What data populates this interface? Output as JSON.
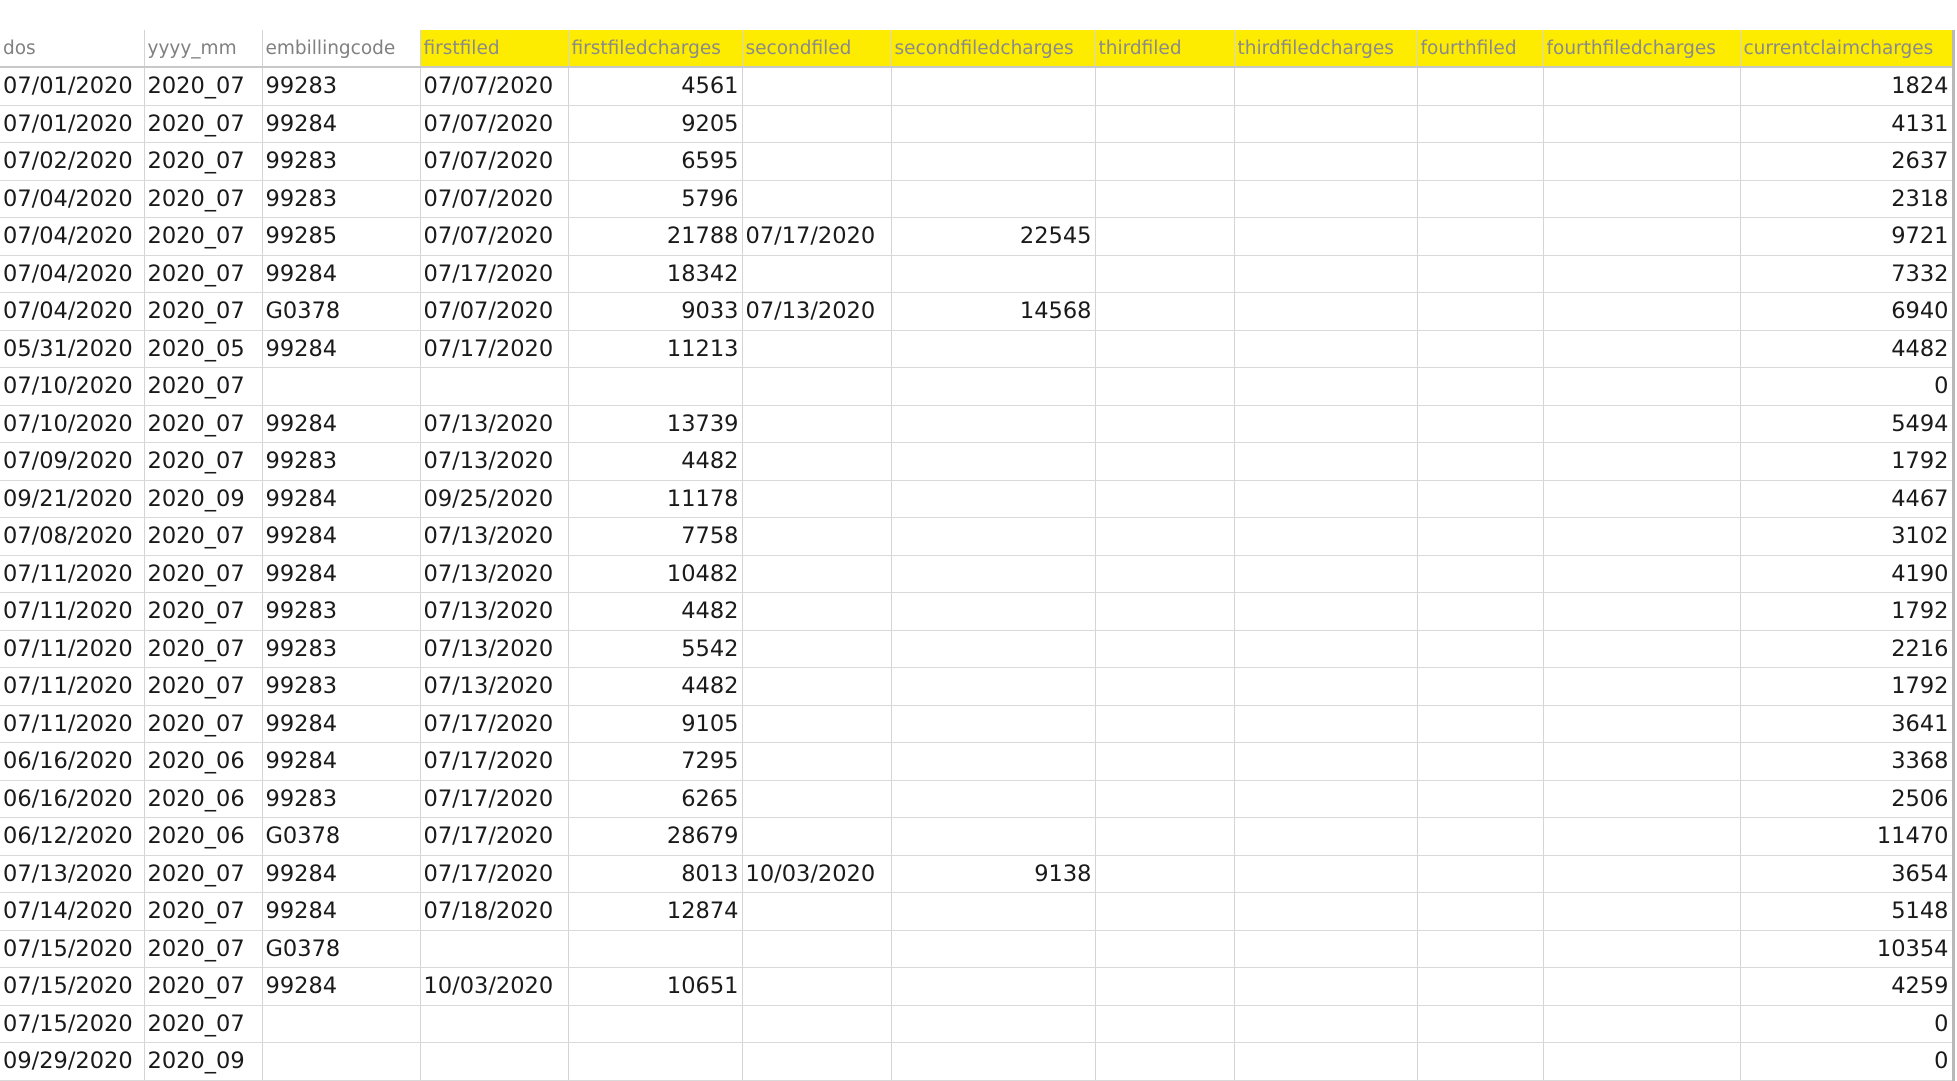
{
  "columns": [
    {
      "key": "dos",
      "label": "dos",
      "highlight": false,
      "align": "left"
    },
    {
      "key": "yyyy_mm",
      "label": "yyyy_mm",
      "highlight": false,
      "align": "left"
    },
    {
      "key": "embillingcode",
      "label": "embillingcode",
      "highlight": false,
      "align": "left"
    },
    {
      "key": "firstfiled",
      "label": "firstfiled",
      "highlight": true,
      "align": "left"
    },
    {
      "key": "firstfiledcharges",
      "label": "firstfiledcharges",
      "highlight": true,
      "align": "right"
    },
    {
      "key": "secondfiled",
      "label": "secondfiled",
      "highlight": true,
      "align": "left"
    },
    {
      "key": "secondfiledcharges",
      "label": "secondfiledcharges",
      "highlight": true,
      "align": "right"
    },
    {
      "key": "thirdfiled",
      "label": "thirdfiled",
      "highlight": true,
      "align": "left"
    },
    {
      "key": "thirdfiledcharges",
      "label": "thirdfiledcharges",
      "highlight": true,
      "align": "right"
    },
    {
      "key": "fourthfiled",
      "label": "fourthfiled",
      "highlight": true,
      "align": "left"
    },
    {
      "key": "fourthfiledcharges",
      "label": "fourthfiledcharges",
      "highlight": true,
      "align": "right"
    },
    {
      "key": "currentclaimcharges",
      "label": "currentclaimcharges",
      "highlight": true,
      "align": "right"
    }
  ],
  "highlight_color": "#fdeb00",
  "rows": [
    [
      "07/01/2020",
      "2020_07",
      "99283",
      "07/07/2020",
      "4561",
      "",
      "",
      "",
      "",
      "",
      "",
      "1824"
    ],
    [
      "07/01/2020",
      "2020_07",
      "99284",
      "07/07/2020",
      "9205",
      "",
      "",
      "",
      "",
      "",
      "",
      "4131"
    ],
    [
      "07/02/2020",
      "2020_07",
      "99283",
      "07/07/2020",
      "6595",
      "",
      "",
      "",
      "",
      "",
      "",
      "2637"
    ],
    [
      "07/04/2020",
      "2020_07",
      "99283",
      "07/07/2020",
      "5796",
      "",
      "",
      "",
      "",
      "",
      "",
      "2318"
    ],
    [
      "07/04/2020",
      "2020_07",
      "99285",
      "07/07/2020",
      "21788",
      "07/17/2020",
      "22545",
      "",
      "",
      "",
      "",
      "9721"
    ],
    [
      "07/04/2020",
      "2020_07",
      "99284",
      "07/17/2020",
      "18342",
      "",
      "",
      "",
      "",
      "",
      "",
      "7332"
    ],
    [
      "07/04/2020",
      "2020_07",
      "G0378",
      "07/07/2020",
      "9033",
      "07/13/2020",
      "14568",
      "",
      "",
      "",
      "",
      "6940"
    ],
    [
      "05/31/2020",
      "2020_05",
      "99284",
      "07/17/2020",
      "11213",
      "",
      "",
      "",
      "",
      "",
      "",
      "4482"
    ],
    [
      "07/10/2020",
      "2020_07",
      "",
      "",
      "",
      "",
      "",
      "",
      "",
      "",
      "",
      "0"
    ],
    [
      "07/10/2020",
      "2020_07",
      "99284",
      "07/13/2020",
      "13739",
      "",
      "",
      "",
      "",
      "",
      "",
      "5494"
    ],
    [
      "07/09/2020",
      "2020_07",
      "99283",
      "07/13/2020",
      "4482",
      "",
      "",
      "",
      "",
      "",
      "",
      "1792"
    ],
    [
      "09/21/2020",
      "2020_09",
      "99284",
      "09/25/2020",
      "11178",
      "",
      "",
      "",
      "",
      "",
      "",
      "4467"
    ],
    [
      "07/08/2020",
      "2020_07",
      "99284",
      "07/13/2020",
      "7758",
      "",
      "",
      "",
      "",
      "",
      "",
      "3102"
    ],
    [
      "07/11/2020",
      "2020_07",
      "99284",
      "07/13/2020",
      "10482",
      "",
      "",
      "",
      "",
      "",
      "",
      "4190"
    ],
    [
      "07/11/2020",
      "2020_07",
      "99283",
      "07/13/2020",
      "4482",
      "",
      "",
      "",
      "",
      "",
      "",
      "1792"
    ],
    [
      "07/11/2020",
      "2020_07",
      "99283",
      "07/13/2020",
      "5542",
      "",
      "",
      "",
      "",
      "",
      "",
      "2216"
    ],
    [
      "07/11/2020",
      "2020_07",
      "99283",
      "07/13/2020",
      "4482",
      "",
      "",
      "",
      "",
      "",
      "",
      "1792"
    ],
    [
      "07/11/2020",
      "2020_07",
      "99284",
      "07/17/2020",
      "9105",
      "",
      "",
      "",
      "",
      "",
      "",
      "3641"
    ],
    [
      "06/16/2020",
      "2020_06",
      "99284",
      "07/17/2020",
      "7295",
      "",
      "",
      "",
      "",
      "",
      "",
      "3368"
    ],
    [
      "06/16/2020",
      "2020_06",
      "99283",
      "07/17/2020",
      "6265",
      "",
      "",
      "",
      "",
      "",
      "",
      "2506"
    ],
    [
      "06/12/2020",
      "2020_06",
      "G0378",
      "07/17/2020",
      "28679",
      "",
      "",
      "",
      "",
      "",
      "",
      "11470"
    ],
    [
      "07/13/2020",
      "2020_07",
      "99284",
      "07/17/2020",
      "8013",
      "10/03/2020",
      "9138",
      "",
      "",
      "",
      "",
      "3654"
    ],
    [
      "07/14/2020",
      "2020_07",
      "99284",
      "07/18/2020",
      "12874",
      "",
      "",
      "",
      "",
      "",
      "",
      "5148"
    ],
    [
      "07/15/2020",
      "2020_07",
      "G0378",
      "",
      "",
      "",
      "",
      "",
      "",
      "",
      "",
      "10354"
    ],
    [
      "07/15/2020",
      "2020_07",
      "99284",
      "10/03/2020",
      "10651",
      "",
      "",
      "",
      "",
      "",
      "",
      "4259"
    ],
    [
      "07/15/2020",
      "2020_07",
      "",
      "",
      "",
      "",
      "",
      "",
      "",
      "",
      "",
      "0"
    ],
    [
      "09/29/2020",
      "2020_09",
      "",
      "",
      "",
      "",
      "",
      "",
      "",
      "",
      "",
      "0"
    ]
  ]
}
